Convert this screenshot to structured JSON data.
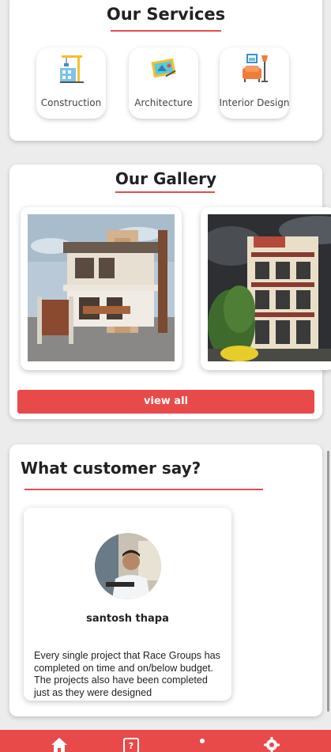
{
  "services": {
    "title": "Our Services",
    "items": [
      {
        "label": "Construction",
        "icon": "construction-icon"
      },
      {
        "label": "Architecture",
        "icon": "architecture-icon"
      },
      {
        "label": "Interior Design",
        "icon": "interior-design-icon"
      }
    ]
  },
  "gallery": {
    "title": "Our Gallery",
    "items": [
      {
        "icon": "house-photo"
      },
      {
        "icon": "building-photo"
      }
    ],
    "view_all_label": "view all"
  },
  "testimonials": {
    "title": "What customer say?",
    "items": [
      {
        "author": "santosh thapa",
        "quote": "Every single project that Race Groups has completed on time and on/below budget. The projects also have been completed just as they were designed"
      }
    ]
  },
  "bottom_nav": {
    "items": [
      {
        "icon": "home-icon"
      },
      {
        "icon": "help-icon"
      },
      {
        "icon": "info-icon"
      },
      {
        "icon": "settings-icon"
      }
    ]
  },
  "colors": {
    "accent": "#e84a4a",
    "background": "#ececec",
    "card": "#ffffff"
  }
}
